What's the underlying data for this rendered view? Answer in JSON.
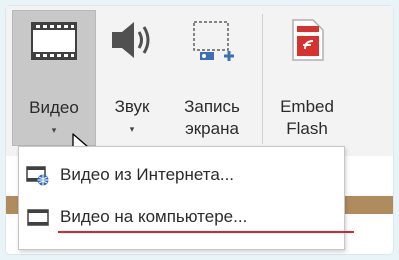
{
  "ribbon": {
    "buttons": [
      {
        "label": "Видео",
        "has_dropdown": true,
        "pressed": true
      },
      {
        "label": "Звук",
        "has_dropdown": true,
        "pressed": false
      },
      {
        "label": "Запись\nэкрана",
        "has_dropdown": false,
        "pressed": false
      },
      {
        "label": "Embed\nFlash",
        "has_dropdown": false,
        "pressed": false
      }
    ],
    "arrow_glyph": "▾"
  },
  "menu": {
    "items": [
      {
        "label": "Видео из Интернета...",
        "icon": "online-video-icon",
        "hotkey_letter": "д"
      },
      {
        "label": "Видео на компьютере...",
        "icon": "video-on-computer-icon",
        "hotkey_letter": "В",
        "highlighted": true
      }
    ]
  },
  "colors": {
    "ribbon_bg": "#f3f3f3",
    "pressed_bg": "#c8c8c8",
    "accent_underline": "#d9262c",
    "flash_red": "#d8322e"
  }
}
